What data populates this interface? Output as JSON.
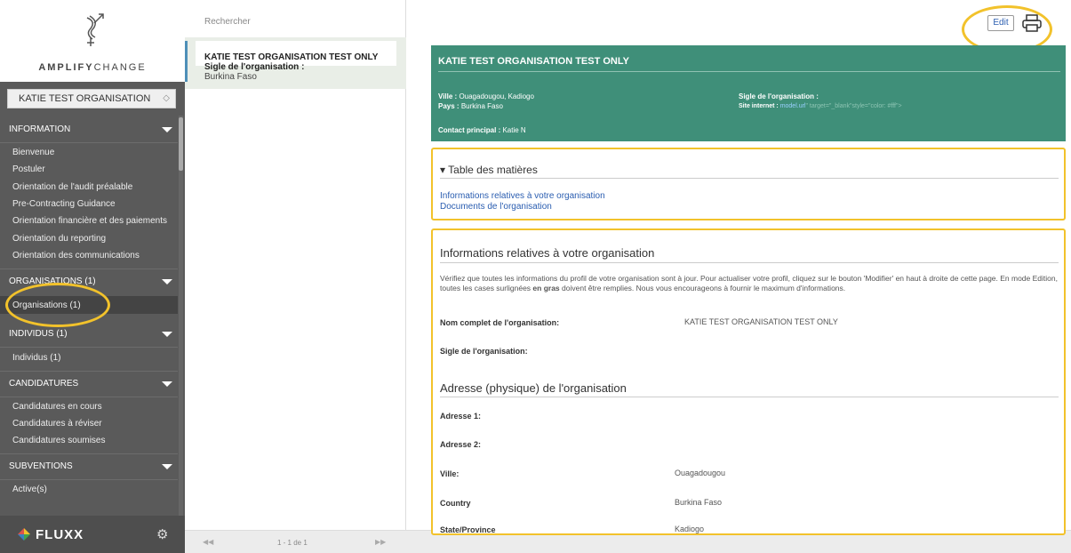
{
  "sidebar": {
    "brand_bold": "AMPLIFY",
    "brand_light": "CHANGE",
    "org_select": "KATIE TEST ORGANISATION",
    "sections": [
      {
        "title": "INFORMATION",
        "items": [
          "Bienvenue",
          "Postuler",
          "Orientation de l'audit préalable",
          "Pre-Contracting Guidance",
          "Orientation financière et des paiements",
          "Orientation du reporting",
          "Orientation des communications"
        ]
      },
      {
        "title": "ORGANISATIONS (1)",
        "items": [
          "Organisations (1)"
        ]
      },
      {
        "title": "INDIVIDUS (1)",
        "items": [
          "Individus (1)"
        ]
      },
      {
        "title": "CANDIDATURES",
        "items": [
          "Candidatures en cours",
          "Candidatures à réviser",
          "Candidatures soumises"
        ]
      },
      {
        "title": "SUBVENTIONS",
        "items": [
          "Active(s)"
        ]
      }
    ],
    "footer_brand": "FLUXX",
    "diamond_colors": [
      "#f2c22b",
      "#3fa34d",
      "#3a7fc1",
      "#d9534f"
    ]
  },
  "list": {
    "search_placeholder": "Rechercher",
    "item_title": "KATIE TEST ORGANISATION TEST ONLY",
    "item_sub": "Sigle de l'organisation :",
    "item_country": "Burkina Faso",
    "pager_prev": "◀◀",
    "pager_count": "1 - 1 de 1",
    "pager_next": "▶▶"
  },
  "detail": {
    "edit_label": "Edit",
    "header": {
      "title": "KATIE TEST ORGANISATION TEST ONLY",
      "ville_label": "Ville :",
      "ville_value": "Ouagadougou, Kadiogo",
      "pays_label": "Pays :",
      "pays_value": "Burkina Faso",
      "sigle_label": "Sigle de l'organisation :",
      "site_label": "Site internet :",
      "site_link": "model.url",
      "site_tail": "\" target=\"_blank\"style=\"color: #fff\">",
      "contact_label": "Contact principal :",
      "contact_value": "Katie N"
    },
    "toc": {
      "title": "▾ Table des matières",
      "links": [
        "Informations relatives à votre organisation",
        "Documents de l'organisation"
      ]
    },
    "info": {
      "title": "Informations relatives à votre organisation",
      "para_a": "Vérifiez que toutes les informations du profil de votre organisation sont à jour. Pour actualiser votre profil, cliquez sur le bouton 'Modifier' en haut à droite de cette page. En mode Edition, toutes les cases surlignées ",
      "para_bold": "en gras",
      "para_b": " doivent être remplies. Nous vous encourageons à fournir le maximum d'informations.",
      "fields": [
        {
          "label": "Nom complet de l'organisation:",
          "value": "KATIE TEST ORGANISATION TEST ONLY"
        },
        {
          "label": "Sigle de l'organisation:",
          "value": ""
        }
      ],
      "address_title": "Adresse (physique) de l'organisation",
      "address_fields": [
        {
          "label": "Adresse 1:",
          "value": ""
        },
        {
          "label": "Adresse 2:",
          "value": ""
        },
        {
          "label": "Ville:",
          "value": "Ouagadougou"
        },
        {
          "label": "Country",
          "value": "Burkina Faso"
        },
        {
          "label": "State/Province",
          "value": "Kadiogo"
        }
      ]
    }
  }
}
